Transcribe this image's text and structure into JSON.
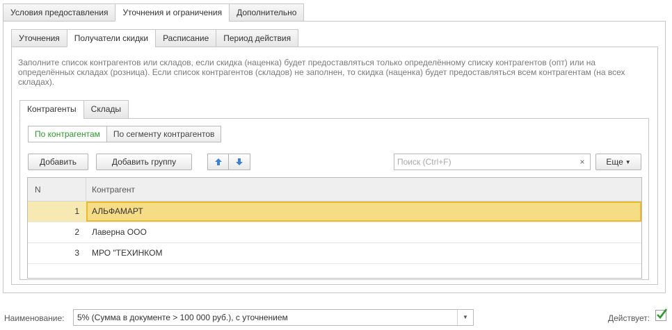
{
  "main_tabs": [
    "Условия предоставления",
    "Уточнения и ограничения",
    "Дополнительно"
  ],
  "main_active_tab": "Уточнения и ограничения",
  "sub_tabs": [
    "Уточнения",
    "Получатели скидки",
    "Расписание",
    "Период действия"
  ],
  "sub_active_tab": "Получатели скидки",
  "info_text": "Заполните список контрагентов или складов, если скидка (наценка) будет предоставляться только определённому списку контрагентов (опт) или на определённых складах (розница). Если список контрагентов (складов) не заполнен, то скидка (наценка) будет предоставляться всем контрагентам (на всех складах).",
  "inner_tabs": [
    "Контрагенты",
    "Склады"
  ],
  "inner_active_tab": "Контрагенты",
  "segment": {
    "by_counterparty": "По контрагентам",
    "by_segment": "По сегменту контрагентов"
  },
  "toolbar": {
    "add_label": "Добавить",
    "add_group_label": "Добавить группу",
    "search_placeholder": "Поиск (Ctrl+F)",
    "clear_symbol": "×",
    "more_label": "Еще"
  },
  "icons": {
    "move_up": "arrow-up-icon",
    "move_down": "arrow-down-icon",
    "check": "checkmark-icon"
  },
  "table": {
    "columns": [
      "N",
      "Контрагент"
    ],
    "rows": [
      {
        "n": "1",
        "name": "АЛЬФАМАРТ",
        "selected": true
      },
      {
        "n": "2",
        "name": "Лаверна ООО",
        "selected": false
      },
      {
        "n": "3",
        "name": "МРО \"ТЕХИНКОМ",
        "selected": false
      }
    ]
  },
  "footer": {
    "name_label": "Наименование:",
    "name_value": "5% (Сумма в документе > 100 000 руб.), с уточнением",
    "active_label": "Действует:",
    "active_checked": true
  },
  "colors": {
    "accent_green": "#2c9a2c",
    "arrow_blue": "#3b82d6",
    "selection_row": "#f6eab2",
    "selection_cell": "#f7dc86",
    "selection_border": "#e9b92e"
  }
}
